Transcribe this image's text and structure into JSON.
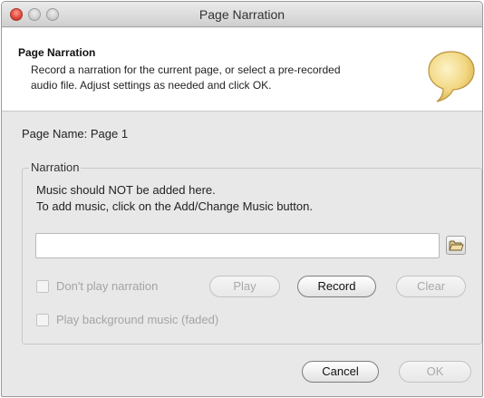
{
  "window": {
    "title": "Page Narration"
  },
  "header": {
    "title": "Page Narration",
    "description_line1": "Record a narration for the current page, or select a pre-recorded",
    "description_line2": "audio file. Adjust settings as needed and click OK.",
    "icon": "speech-bubble-icon"
  },
  "page_name": "Page Name: Page 1",
  "narration": {
    "legend": "Narration",
    "note_line1": "Music should NOT be added here.",
    "note_line2": "To add music, click on the Add/Change Music button.",
    "file_value": "",
    "browse_icon": "open-folder-icon",
    "dont_play": {
      "label": "Don't play narration",
      "checked": false,
      "enabled": false
    },
    "play_bg_music": {
      "label": "Play background music (faded)",
      "checked": false,
      "enabled": false
    },
    "buttons": {
      "play": {
        "label": "Play",
        "enabled": false
      },
      "record": {
        "label": "Record",
        "enabled": true
      },
      "clear": {
        "label": "Clear",
        "enabled": false
      }
    }
  },
  "footer": {
    "cancel": {
      "label": "Cancel",
      "enabled": true
    },
    "ok": {
      "label": "OK",
      "enabled": false
    }
  },
  "colors": {
    "bubble_fill": "#f2d883",
    "close_button": "#e0443a",
    "window_background": "#e8e8e8"
  }
}
